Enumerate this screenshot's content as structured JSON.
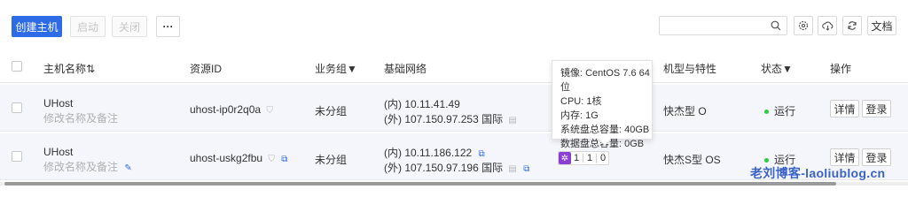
{
  "toolbar": {
    "create_label": "创建主机",
    "start_label": "启动",
    "stop_label": "关闭",
    "more_label": "···",
    "search_placeholder": "",
    "docs_label": "文档"
  },
  "columns": {
    "host_name": "主机名称⇅",
    "resource_id": "资源ID",
    "business_group": "业务组▼",
    "network": "基础网络",
    "model": "机型与特性",
    "status": "状态▼",
    "operations": "操作"
  },
  "tooltip": {
    "image": "镜像: CentOS 7.6 64位",
    "cpu": "CPU: 1核",
    "memory": "内存: 1G",
    "system_disk": "系统盘总容量: 40GB",
    "data_disk": "数据盘总容量: 0GB"
  },
  "rows": [
    {
      "name": "UHost",
      "remark": "修改名称及备注",
      "resource_id": "uhost-ip0r2q0a",
      "group": "未分组",
      "internal_ip": "(内) 10.11.41.49",
      "external_ip": "(外) 107.150.97.253 国际",
      "model": "快杰型 O",
      "status": "运行",
      "detail_label": "详情",
      "login_label": "登录"
    },
    {
      "name": "UHost",
      "remark": "修改名称及备注",
      "resource_id": "uhost-uskg2fbu",
      "group": "未分组",
      "internal_ip": "(内) 10.11.186.122",
      "external_ip": "(外) 107.150.97.196 国际",
      "spec_cpu": "1",
      "spec_mem": "1",
      "spec_gpu": "0",
      "model": "快杰S型 OS",
      "status": "运行",
      "detail_label": "详情",
      "login_label": "登录"
    }
  ],
  "watermark": "老刘博客-laoliublog.cn",
  "colors": {
    "primary": "#2e6be6",
    "status_running": "#2ecc40",
    "spec_icon": "#8a3ed4",
    "watermark": "#3a63c9"
  }
}
